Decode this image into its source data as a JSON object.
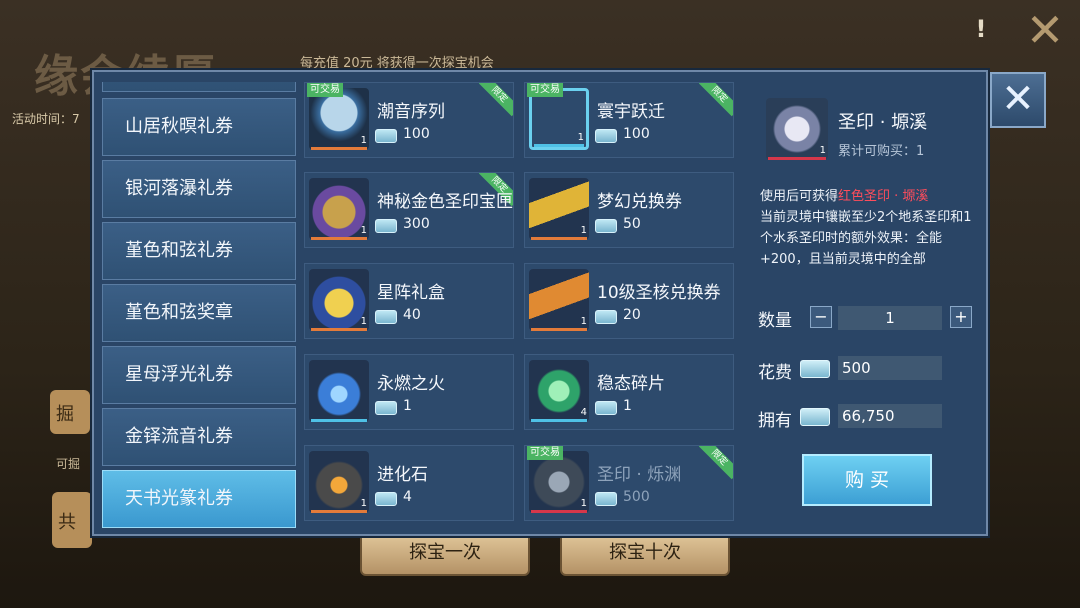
{
  "background": {
    "title": "缘会续愿",
    "time_label": "活动时间：7",
    "charge_note": "每充值 20元 将获得一次探宝机会",
    "dig_label": "掘",
    "dig_note": "可掘",
    "total_label": "共",
    "btn_once": "探宝一次",
    "btn_ten": "探宝十次",
    "alert_icon": "!",
    "close_icon": "✕"
  },
  "modal": {
    "close_icon": "✕",
    "sidebar": {
      "items": [
        {
          "label": ""
        },
        {
          "label": "山居秋暝礼券"
        },
        {
          "label": "银河落瀑礼券"
        },
        {
          "label": "堇色和弦礼券"
        },
        {
          "label": "堇色和弦奖章"
        },
        {
          "label": "星母浮光礼券"
        },
        {
          "label": "金铎流音礼券"
        },
        {
          "label": "天书光篆礼券"
        }
      ],
      "active_index": 7
    },
    "grid": {
      "items": [
        {
          "name": "潮音序列",
          "price": "100",
          "count": "1",
          "trade": "可交易",
          "limit": "限定"
        },
        {
          "name": "寰宇跃迁",
          "price": "100",
          "count": "1",
          "trade": "可交易",
          "limit": "限定"
        },
        {
          "name": "神秘金色圣印宝匣",
          "price": "300",
          "count": "1",
          "trade": "",
          "limit": "限定"
        },
        {
          "name": "梦幻兑换券",
          "price": "50",
          "count": "1",
          "trade": "",
          "limit": ""
        },
        {
          "name": "星阵礼盒",
          "price": "40",
          "count": "1",
          "trade": "",
          "limit": ""
        },
        {
          "name": "10级圣核兑换券",
          "price": "20",
          "count": "1",
          "trade": "",
          "limit": ""
        },
        {
          "name": "永燃之火",
          "price": "1",
          "count": "",
          "trade": "",
          "limit": ""
        },
        {
          "name": "稳态碎片",
          "price": "1",
          "count": "4",
          "trade": "",
          "limit": ""
        },
        {
          "name": "进化石",
          "price": "4",
          "count": "1",
          "trade": "",
          "limit": ""
        },
        {
          "name": "圣印 · 烁渊",
          "price": "500",
          "count": "1",
          "trade": "可交易",
          "limit": "限定"
        }
      ]
    },
    "detail": {
      "name": "圣印 · 塬溪",
      "count": "1",
      "limit_text": "累计可购买：1",
      "desc_prefix": "使用后可获得",
      "desc_highlight": "红色圣印 · 塬溪",
      "desc_rest": "当前灵境中镶嵌至少2个地系圣印和1个水系圣印时的额外效果：全能+200，且当前灵境中的全部",
      "qty_label": "数量",
      "minus": "−",
      "plus": "+",
      "qty": "1",
      "cost_label": "花费",
      "cost": "500",
      "own_label": "拥有",
      "own": "66,750",
      "buy_label": "购 买"
    }
  },
  "colors": {
    "accent": "#3c9fd4",
    "highlight": "#ff4d5c",
    "trade_badge": "#4bb463"
  }
}
